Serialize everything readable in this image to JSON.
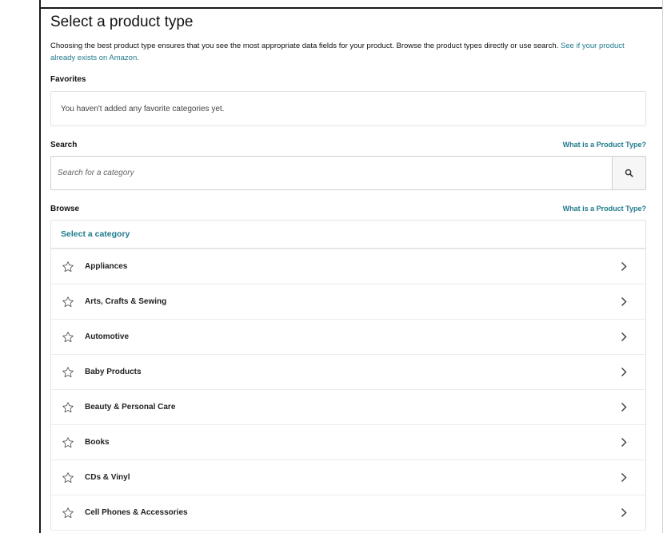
{
  "header": {
    "title": "Select a product type",
    "intro_text": "Choosing the best product type ensures that you see the most appropriate data fields for your product. Browse the product types directly or use search.",
    "intro_link": "See if your product already exists on Amazon."
  },
  "favorites": {
    "label": "Favorites",
    "empty_text": "You haven't added any favorite categories yet."
  },
  "search": {
    "label": "Search",
    "help_link": "What is a Product Type?",
    "placeholder": "Search for a category",
    "button_icon": "search-icon"
  },
  "browse": {
    "label": "Browse",
    "help_link": "What is a Product Type?",
    "header": "Select a category",
    "categories": [
      {
        "label": "Appliances",
        "icon": "star-outline-icon"
      },
      {
        "label": "Arts, Crafts & Sewing",
        "icon": "star-outline-icon"
      },
      {
        "label": "Automotive",
        "icon": "star-outline-icon"
      },
      {
        "label": "Baby Products",
        "icon": "star-outline-icon"
      },
      {
        "label": "Beauty & Personal Care",
        "icon": "star-outline-icon"
      },
      {
        "label": "Books",
        "icon": "star-outline-icon"
      },
      {
        "label": "CDs & Vinyl",
        "icon": "star-outline-icon"
      },
      {
        "label": "Cell Phones & Accessories",
        "icon": "star-outline-icon"
      }
    ]
  },
  "colors": {
    "link": "#1f7a8c",
    "text": "#111111",
    "border": "#e3e3e3"
  }
}
